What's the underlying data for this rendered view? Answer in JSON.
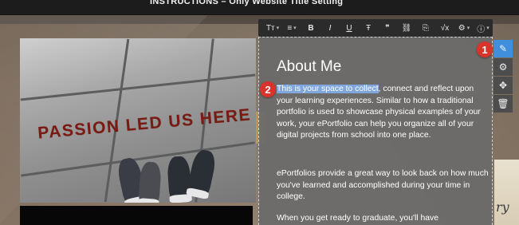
{
  "header": {
    "title": "INSTRUCTIONS – Only Website Title Setting"
  },
  "photo": {
    "caption": "PASSION LED US HERE"
  },
  "toolbar": {
    "buttons": [
      {
        "label": "Tт",
        "icon": "font-size-icon",
        "has_caret": true
      },
      {
        "label": "≡",
        "icon": "paragraph-format-icon",
        "has_caret": true
      },
      {
        "label": "B",
        "icon": "bold-icon"
      },
      {
        "label": "I",
        "icon": "italic-icon"
      },
      {
        "label": "U",
        "icon": "underline-icon"
      },
      {
        "label": "Ŧ",
        "icon": "strikethrough-icon"
      },
      {
        "label": "❞",
        "icon": "quote-icon"
      },
      {
        "label": "⛓",
        "icon": "link-icon"
      },
      {
        "label": "⎘",
        "icon": "attachment-icon"
      },
      {
        "label": "√x",
        "icon": "formula-icon"
      },
      {
        "label": "⚙",
        "icon": "color-icon",
        "has_caret": true
      },
      {
        "label": "ⓘ",
        "icon": "info-icon",
        "has_caret": true
      }
    ]
  },
  "content": {
    "heading": "About Me",
    "para1_highlight": "This is your space to collect",
    "para1_rest": ", connect and reflect upon your learning experiences.  Similar to how a traditional portfolio is used to showcase physical examples of your work, your ePortfolio can help you organize all of your digital projects from school into one place.",
    "para2": "ePortfolios provide a great way to look back on how much you've learned and accomplished during your time in college.",
    "para3": "When you get ready to graduate, you'll have"
  },
  "callouts": {
    "one": "1",
    "two": "2"
  },
  "tools": [
    {
      "icon": "edit-icon",
      "glyph": "✎",
      "active": true
    },
    {
      "icon": "settings-icon",
      "glyph": "⚙"
    },
    {
      "icon": "move-icon",
      "glyph": "✥"
    },
    {
      "icon": "trash-icon",
      "glyph": "🗑"
    }
  ],
  "colors": {
    "accent": "#3f8fdc",
    "callout": "#d9342b",
    "highlight": "#7fa7dc"
  }
}
